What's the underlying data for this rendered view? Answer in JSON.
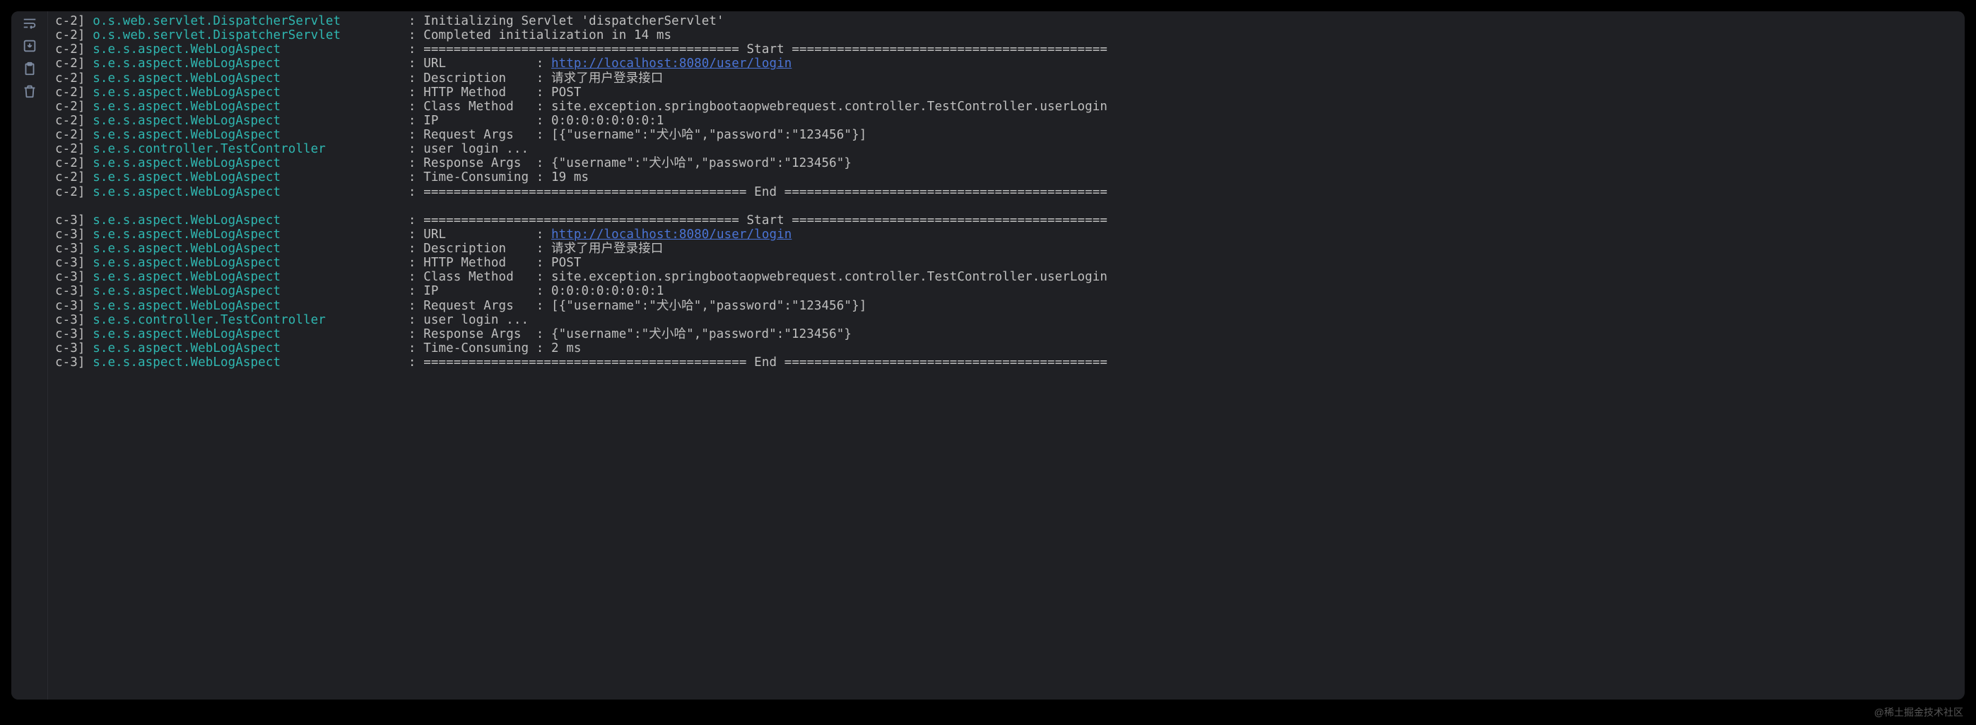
{
  "watermark": "@稀土掘金技术社区",
  "gutter_icons": [
    {
      "name": "wrap-icon"
    },
    {
      "name": "download-icon"
    },
    {
      "name": "clipboard-icon"
    },
    {
      "name": "trash-icon"
    }
  ],
  "log_lines": [
    {
      "thread": "c-2]",
      "logger": "o.s.web.servlet.DispatcherServlet",
      "padding": 8,
      "msg_prefix": "Initializing Servlet 'dispatcherServlet'",
      "url": null,
      "msg_suffix": ""
    },
    {
      "thread": "c-2]",
      "logger": "o.s.web.servlet.DispatcherServlet",
      "padding": 8,
      "msg_prefix": "Completed initialization in 14 ms",
      "url": null,
      "msg_suffix": ""
    },
    {
      "thread": "c-2]",
      "logger": "s.e.s.aspect.WebLogAspect",
      "padding": 16,
      "msg_prefix": "========================================== Start ==========================================",
      "url": null,
      "msg_suffix": ""
    },
    {
      "thread": "c-2]",
      "logger": "s.e.s.aspect.WebLogAspect",
      "padding": 16,
      "msg_prefix": "URL            : ",
      "url": "http://localhost:8080/user/login",
      "msg_suffix": ""
    },
    {
      "thread": "c-2]",
      "logger": "s.e.s.aspect.WebLogAspect",
      "padding": 16,
      "msg_prefix": "Description    : 请求了用户登录接口",
      "url": null,
      "msg_suffix": ""
    },
    {
      "thread": "c-2]",
      "logger": "s.e.s.aspect.WebLogAspect",
      "padding": 16,
      "msg_prefix": "HTTP Method    : POST",
      "url": null,
      "msg_suffix": ""
    },
    {
      "thread": "c-2]",
      "logger": "s.e.s.aspect.WebLogAspect",
      "padding": 16,
      "msg_prefix": "Class Method   : site.exception.springbootaopwebrequest.controller.TestController.userLogin",
      "url": null,
      "msg_suffix": ""
    },
    {
      "thread": "c-2]",
      "logger": "s.e.s.aspect.WebLogAspect",
      "padding": 16,
      "msg_prefix": "IP             : 0:0:0:0:0:0:0:1",
      "url": null,
      "msg_suffix": ""
    },
    {
      "thread": "c-2]",
      "logger": "s.e.s.aspect.WebLogAspect",
      "padding": 16,
      "msg_prefix": "Request Args   : [{\"username\":\"犬小哈\",\"password\":\"123456\"}]",
      "url": null,
      "msg_suffix": ""
    },
    {
      "thread": "c-2]",
      "logger": "s.e.s.controller.TestController",
      "padding": 10,
      "msg_prefix": "user login ...",
      "url": null,
      "msg_suffix": ""
    },
    {
      "thread": "c-2]",
      "logger": "s.e.s.aspect.WebLogAspect",
      "padding": 16,
      "msg_prefix": "Response Args  : {\"username\":\"犬小哈\",\"password\":\"123456\"}",
      "url": null,
      "msg_suffix": ""
    },
    {
      "thread": "c-2]",
      "logger": "s.e.s.aspect.WebLogAspect",
      "padding": 16,
      "msg_prefix": "Time-Consuming : 19 ms",
      "url": null,
      "msg_suffix": ""
    },
    {
      "thread": "c-2]",
      "logger": "s.e.s.aspect.WebLogAspect",
      "padding": 16,
      "msg_prefix": "=========================================== End ===========================================",
      "url": null,
      "msg_suffix": ""
    },
    {
      "blank": true
    },
    {
      "thread": "c-3]",
      "logger": "s.e.s.aspect.WebLogAspect",
      "padding": 16,
      "msg_prefix": "========================================== Start ==========================================",
      "url": null,
      "msg_suffix": ""
    },
    {
      "thread": "c-3]",
      "logger": "s.e.s.aspect.WebLogAspect",
      "padding": 16,
      "msg_prefix": "URL            : ",
      "url": "http://localhost:8080/user/login",
      "msg_suffix": ""
    },
    {
      "thread": "c-3]",
      "logger": "s.e.s.aspect.WebLogAspect",
      "padding": 16,
      "msg_prefix": "Description    : 请求了用户登录接口",
      "url": null,
      "msg_suffix": ""
    },
    {
      "thread": "c-3]",
      "logger": "s.e.s.aspect.WebLogAspect",
      "padding": 16,
      "msg_prefix": "HTTP Method    : POST",
      "url": null,
      "msg_suffix": ""
    },
    {
      "thread": "c-3]",
      "logger": "s.e.s.aspect.WebLogAspect",
      "padding": 16,
      "msg_prefix": "Class Method   : site.exception.springbootaopwebrequest.controller.TestController.userLogin",
      "url": null,
      "msg_suffix": ""
    },
    {
      "thread": "c-3]",
      "logger": "s.e.s.aspect.WebLogAspect",
      "padding": 16,
      "msg_prefix": "IP             : 0:0:0:0:0:0:0:1",
      "url": null,
      "msg_suffix": ""
    },
    {
      "thread": "c-3]",
      "logger": "s.e.s.aspect.WebLogAspect",
      "padding": 16,
      "msg_prefix": "Request Args   : [{\"username\":\"犬小哈\",\"password\":\"123456\"}]",
      "url": null,
      "msg_suffix": ""
    },
    {
      "thread": "c-3]",
      "logger": "s.e.s.controller.TestController",
      "padding": 10,
      "msg_prefix": "user login ...",
      "url": null,
      "msg_suffix": ""
    },
    {
      "thread": "c-3]",
      "logger": "s.e.s.aspect.WebLogAspect",
      "padding": 16,
      "msg_prefix": "Response Args  : {\"username\":\"犬小哈\",\"password\":\"123456\"}",
      "url": null,
      "msg_suffix": ""
    },
    {
      "thread": "c-3]",
      "logger": "s.e.s.aspect.WebLogAspect",
      "padding": 16,
      "msg_prefix": "Time-Consuming : 2 ms",
      "url": null,
      "msg_suffix": ""
    },
    {
      "thread": "c-3]",
      "logger": "s.e.s.aspect.WebLogAspect",
      "padding": 16,
      "msg_prefix": "=========================================== End ===========================================",
      "url": null,
      "msg_suffix": ""
    }
  ],
  "colors": {
    "background": "#1f2024",
    "logger": "#2fb6b0",
    "text": "#bfbfbf",
    "link": "#4b74d6"
  }
}
